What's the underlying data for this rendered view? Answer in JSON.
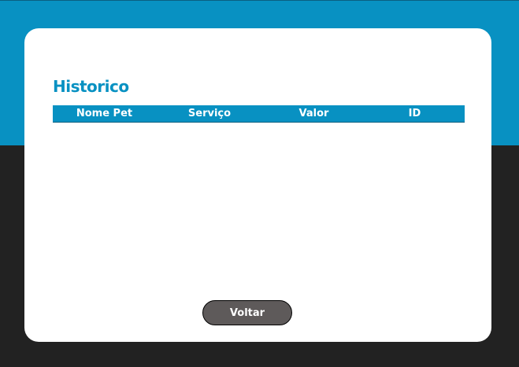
{
  "page": {
    "title": "Historico"
  },
  "table": {
    "columns": [
      "Nome Pet",
      "Serviço",
      "Valor",
      "ID"
    ],
    "rows": []
  },
  "actions": {
    "back_label": "Voltar"
  },
  "colors": {
    "accent": "#0891c2",
    "background_dark": "#222222",
    "card": "#ffffff",
    "button": "#5e5a5a"
  }
}
